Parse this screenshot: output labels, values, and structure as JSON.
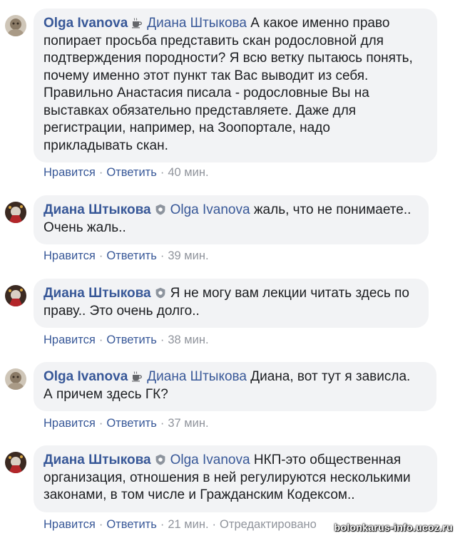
{
  "comments": [
    {
      "author": "Olga Ivanova",
      "badge_icon": "coffee-cup-icon",
      "mention": "Диана Штыкова",
      "lines": [
        "А какое именно право",
        "попирает просьба представить скан родословной для",
        "подтверждения породности? Я всю ветку пытаюсь понять,",
        "почему именно этот пункт так Вас выводит из себя.",
        "Правильно Анастасия писала - родословные Вы на",
        "выставках обязательно представляете. Даже для",
        "регистрации, например, на Зоопортале, надо",
        "прикладывать скан."
      ],
      "like": "Нравится",
      "reply": "Ответить",
      "time": "40 мин."
    },
    {
      "author": "Диана Штыкова",
      "badge_icon": "shield-badge-icon",
      "mention": "Olga Ivanova",
      "lines": [
        "жаль, что не понимаете..",
        "Очень жаль.."
      ],
      "like": "Нравится",
      "reply": "Ответить",
      "time": "39 мин."
    },
    {
      "author": "Диана Штыкова",
      "badge_icon": "shield-badge-icon",
      "mention": "",
      "lines": [
        "Я не могу вам лекции читать здесь по",
        "праву.. Это очень долго.."
      ],
      "like": "Нравится",
      "reply": "Ответить",
      "time": "38 мин."
    },
    {
      "author": "Olga Ivanova",
      "badge_icon": "coffee-cup-icon",
      "mention": "Диана Штыкова",
      "lines": [
        "Диана, вот тут я зависла.",
        "А причем здесь ГК?"
      ],
      "like": "Нравится",
      "reply": "Ответить",
      "time": "37 мин."
    },
    {
      "author": "Диана Штыкова",
      "badge_icon": "shield-badge-icon",
      "mention": "Olga Ivanova",
      "lines": [
        "НКП-это общественная",
        "организация, отношения в ней регулируются несколькими",
        "законами, в том числе и Гражданским Кодексом.."
      ],
      "like": "Нравится",
      "reply": "Ответить",
      "time": "21 мин.",
      "edited": "Отредактировано"
    }
  ],
  "watermark": "bolonkarus-info.ucoz.ru",
  "colors": {
    "link": "#385898",
    "bubble": "#f2f3f5",
    "meta": "#90949c"
  }
}
